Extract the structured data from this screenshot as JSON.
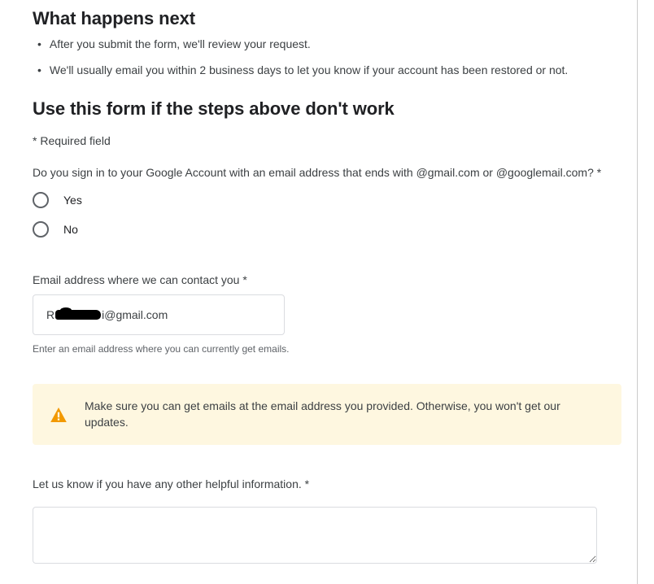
{
  "intro": {
    "heading": "What happens next",
    "bullets": [
      "After you submit the form, we'll review your request.",
      "We'll usually email you within 2 business days to let you know if your account has been restored or not."
    ]
  },
  "form": {
    "heading": "Use this form if the steps above don't work",
    "required_note": "* Required field",
    "gmail_question": {
      "label": "Do you sign in to your Google Account with an email address that ends with @gmail.com or @googlemail.com? *",
      "options": {
        "yes": "Yes",
        "no": "No"
      }
    },
    "contact_email": {
      "label": "Email address where we can contact you *",
      "value_prefix": "R",
      "value_suffix": "i@gmail.com",
      "helper": "Enter an email address where you can currently get emails."
    },
    "notice": {
      "text": "Make sure you can get emails at the email address you provided. Otherwise, you won't get our updates."
    },
    "more_info": {
      "label": "Let us know if you have any other helpful information. *",
      "value": ""
    }
  }
}
